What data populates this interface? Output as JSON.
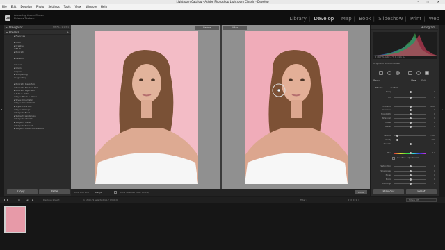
{
  "window": {
    "title": "Lightroom Catalog - Adobe Photoshop Lightroom Classic - Develop",
    "controls": "– ▢ ✕"
  },
  "menu": [
    "File",
    "Edit",
    "Develop",
    "Photo",
    "Settings",
    "Tools",
    "View",
    "Window",
    "Help"
  ],
  "identity": {
    "logo": "Lrc",
    "catalog_line1": "Adobe Lightroom Classic",
    "catalog_line2": "Rhianna Thebeau"
  },
  "modules": {
    "items": [
      "Library",
      "Develop",
      "Map",
      "Book",
      "Slideshow",
      "Print",
      "Web"
    ],
    "active": "Develop"
  },
  "left": {
    "navigator_title": "Navigator",
    "navigator_modes": "FIT  FILL  1:1  3:1",
    "presets_title": "Presets",
    "presets_add": "+",
    "presets": [
      "Favorites",
      "",
      "Color",
      "Creative",
      "B&W",
      "Portraits",
      "",
      "Defaults",
      "",
      "Curve",
      "Grain",
      "Optics",
      "Sharpening",
      "Vignetting",
      "",
      "Portraits Deep Skin",
      "Portraits Medium Skin",
      "Portraits Light Skin",
      "Auto+: Retro",
      "Style: Black & White",
      "Style: Cinematic",
      "Style: Cinematic II",
      "Style: Futuristic",
      "Style: Vintage",
      "Subject: Food",
      "Subject: Landscape",
      "Subject: Lifestyle",
      "Subject: Travel",
      "Subject: Travel II",
      "Subject: Urban Architecture"
    ],
    "copy": "Copy...",
    "paste": "Paste"
  },
  "view": {
    "before": "Before",
    "after": "After"
  },
  "toolbar": {
    "before_after": "Show Edit Pins :",
    "mode": "Always",
    "show_overlay": "Show Selected Mask Overlay",
    "done": "Done"
  },
  "right": {
    "histogram_title": "Histogram",
    "hist_info": "R 46.7 %  G 42.3 %  B 41.1 %",
    "original": "Original + Smart Preview",
    "basic_title": "Basic",
    "basic_mode_new": "New",
    "basic_mode_edit": "Edit",
    "effect_label": "Effect :",
    "effect_value": "Custom",
    "rows": [
      {
        "label": "Temp",
        "value": "0",
        "pos": 0.5
      },
      {
        "label": "Tint",
        "value": "0",
        "pos": 0.5
      },
      {
        "label": "Exposure",
        "value": "0.00",
        "pos": 0.5
      },
      {
        "label": "Contrast",
        "value": "0",
        "pos": 0.5
      },
      {
        "label": "Highlights",
        "value": "0",
        "pos": 0.5
      },
      {
        "label": "Shadows",
        "value": "0",
        "pos": 0.5
      },
      {
        "label": "Whites",
        "value": "0",
        "pos": 0.5
      },
      {
        "label": "Blacks",
        "value": "0",
        "pos": 0.5
      },
      {
        "label": "Texture",
        "value": "-100",
        "pos": 0.08
      },
      {
        "label": "Clarity",
        "value": "-100",
        "pos": 0.08
      },
      {
        "label": "Dehaze",
        "value": "0",
        "pos": 0.5
      },
      {
        "label": "Hue",
        "value": "0.0",
        "pos": 0.5
      },
      {
        "label": "Saturation",
        "value": "0",
        "pos": 0.5
      },
      {
        "label": "Sharpness",
        "value": "0",
        "pos": 0.5
      },
      {
        "label": "Noise",
        "value": "0",
        "pos": 0.5
      },
      {
        "label": "Moiré",
        "value": "0",
        "pos": 0.5
      },
      {
        "label": "Defringe",
        "value": "0",
        "pos": 0.5
      }
    ],
    "fine_adjust": "Use Fine Adjustment",
    "previous": "Previous",
    "reset": "Reset"
  },
  "filmbar": {
    "page1": "1",
    "page2": "2",
    "source": "Previous Import",
    "selection": "1 photo /1 selected /ALP_0304.tif",
    "filter_label": "Filter :",
    "filters_off": "Filters Off"
  },
  "colors": {
    "accent": "#e8e8e8",
    "panel": "#2b2b2b",
    "pink_bg": "#f0abb8"
  }
}
